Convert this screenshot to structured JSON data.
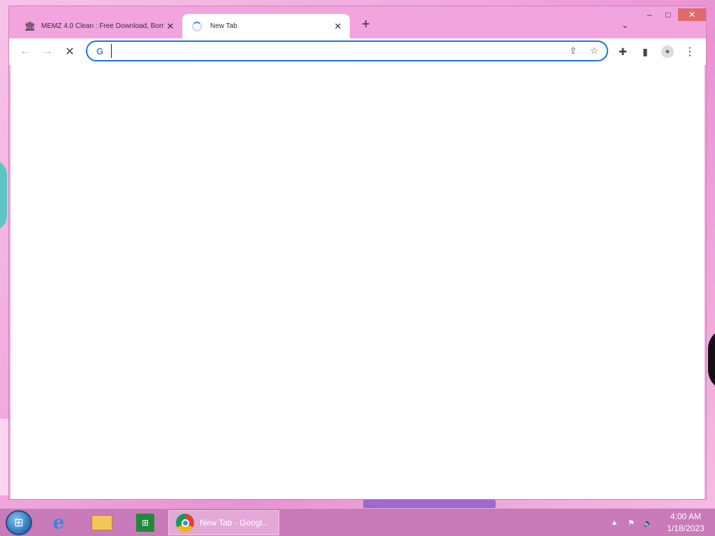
{
  "browser": {
    "tabs": [
      {
        "title": "MEMZ 4.0 Clean : Free Download, Borr",
        "favicon": "archive-institution-icon",
        "active": false
      },
      {
        "title": "New Tab",
        "favicon": "loading-spinner-icon",
        "active": true
      }
    ],
    "new_tab_symbol": "+",
    "tab_search_symbol": "⌄",
    "window_controls": {
      "minimize": "–",
      "maximize": "□",
      "close": "✕"
    },
    "omnibox": {
      "value": "",
      "placeholder": "",
      "logo_text": "G"
    }
  },
  "taskbar": {
    "chrome_button_label": "New Tab - Googl...",
    "clock": {
      "time": "4:00 AM",
      "date": "1/18/2023"
    },
    "tray_icons": [
      "show-hidden-icons-icon",
      "action-center-flag-icon",
      "volume-icon"
    ]
  },
  "colors": {
    "accent": "#1a73e8",
    "window_frame": "#f1a4dd",
    "taskbar": "#c97ab8"
  }
}
